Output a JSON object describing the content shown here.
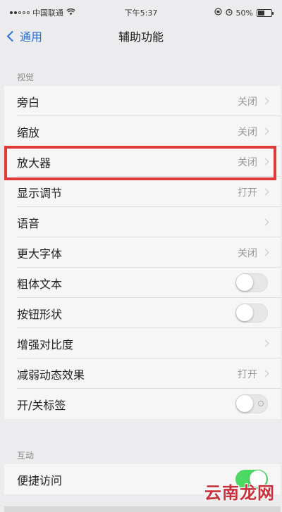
{
  "status_bar": {
    "carrier": "中国联通",
    "time": "下午5:37",
    "battery_percent": "50%",
    "battery_level": 0.5
  },
  "nav": {
    "back_label": "通用",
    "title": "辅助功能"
  },
  "sections": [
    {
      "header": "视觉",
      "rows": [
        {
          "label": "旁白",
          "value": "关闭",
          "kind": "chevron"
        },
        {
          "label": "缩放",
          "value": "关闭",
          "kind": "chevron"
        },
        {
          "label": "放大器",
          "value": "关闭",
          "kind": "chevron",
          "highlighted": true
        },
        {
          "label": "显示调节",
          "value": "打开",
          "kind": "chevron"
        },
        {
          "label": "语音",
          "value": "",
          "kind": "chevron"
        },
        {
          "label": "更大字体",
          "value": "关闭",
          "kind": "chevron"
        },
        {
          "label": "粗体文本",
          "kind": "toggle",
          "on": false
        },
        {
          "label": "按钮形状",
          "kind": "toggle",
          "on": false
        },
        {
          "label": "增强对比度",
          "value": "",
          "kind": "chevron"
        },
        {
          "label": "减弱动态效果",
          "value": "打开",
          "kind": "chevron"
        },
        {
          "label": "开/关标签",
          "kind": "toggle",
          "on": false,
          "label_icon": true
        }
      ]
    },
    {
      "header": "互动",
      "rows": [
        {
          "label": "便捷访问",
          "kind": "toggle",
          "on": true
        }
      ]
    }
  ],
  "watermark": "云南龙网",
  "colors": {
    "accent": "#2a6fd6",
    "toggle_on": "#4cd964",
    "highlight": "#e03a3a",
    "watermark": "#c8313b"
  }
}
